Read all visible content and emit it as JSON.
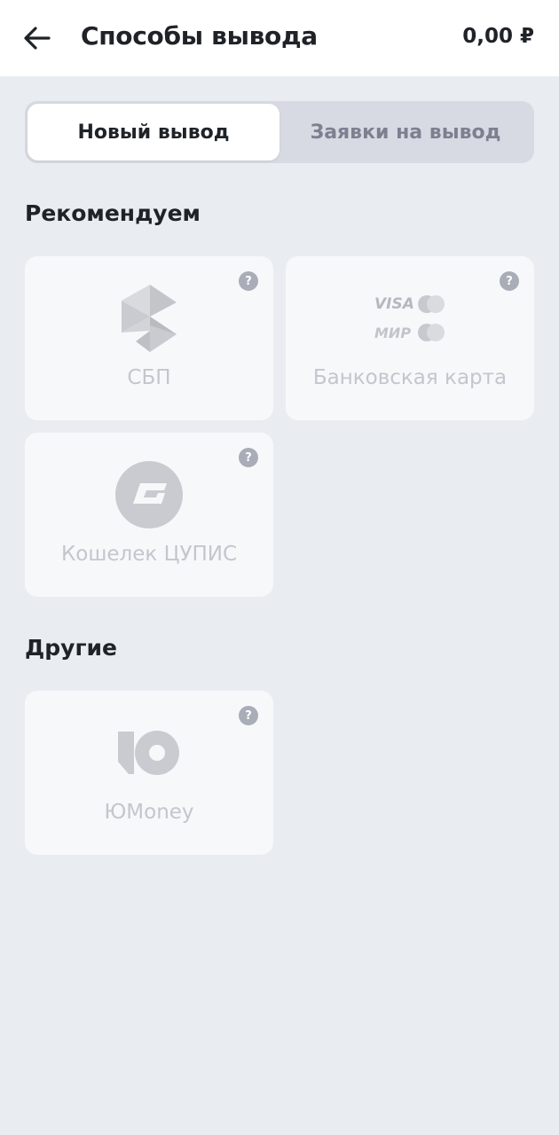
{
  "header": {
    "title": "Способы вывода",
    "balance": "0,00 ₽"
  },
  "tabs": [
    {
      "label": "Новый вывод",
      "active": true
    },
    {
      "label": "Заявки на вывод",
      "active": false
    }
  ],
  "sections": {
    "recommended": {
      "title": "Рекомендуем",
      "methods": [
        {
          "label": "СБП",
          "icon": "sbp-logo-icon"
        },
        {
          "label": "Банковская карта",
          "icon": "bank-card-logos-icon",
          "logos": [
            "VISA",
            "МИР"
          ]
        },
        {
          "label": "Кошелек ЦУПИС",
          "icon": "cupis-logo-icon"
        }
      ]
    },
    "other": {
      "title": "Другие",
      "methods": [
        {
          "label": "ЮMoney",
          "icon": "yumoney-logo-icon"
        }
      ]
    }
  },
  "help_symbol": "?",
  "colors": {
    "background": "#e9ecf1",
    "card": "#f7f8fa",
    "header": "#ffffff",
    "muted": "#c3c6cd",
    "help_badge": "#a9adb7"
  }
}
